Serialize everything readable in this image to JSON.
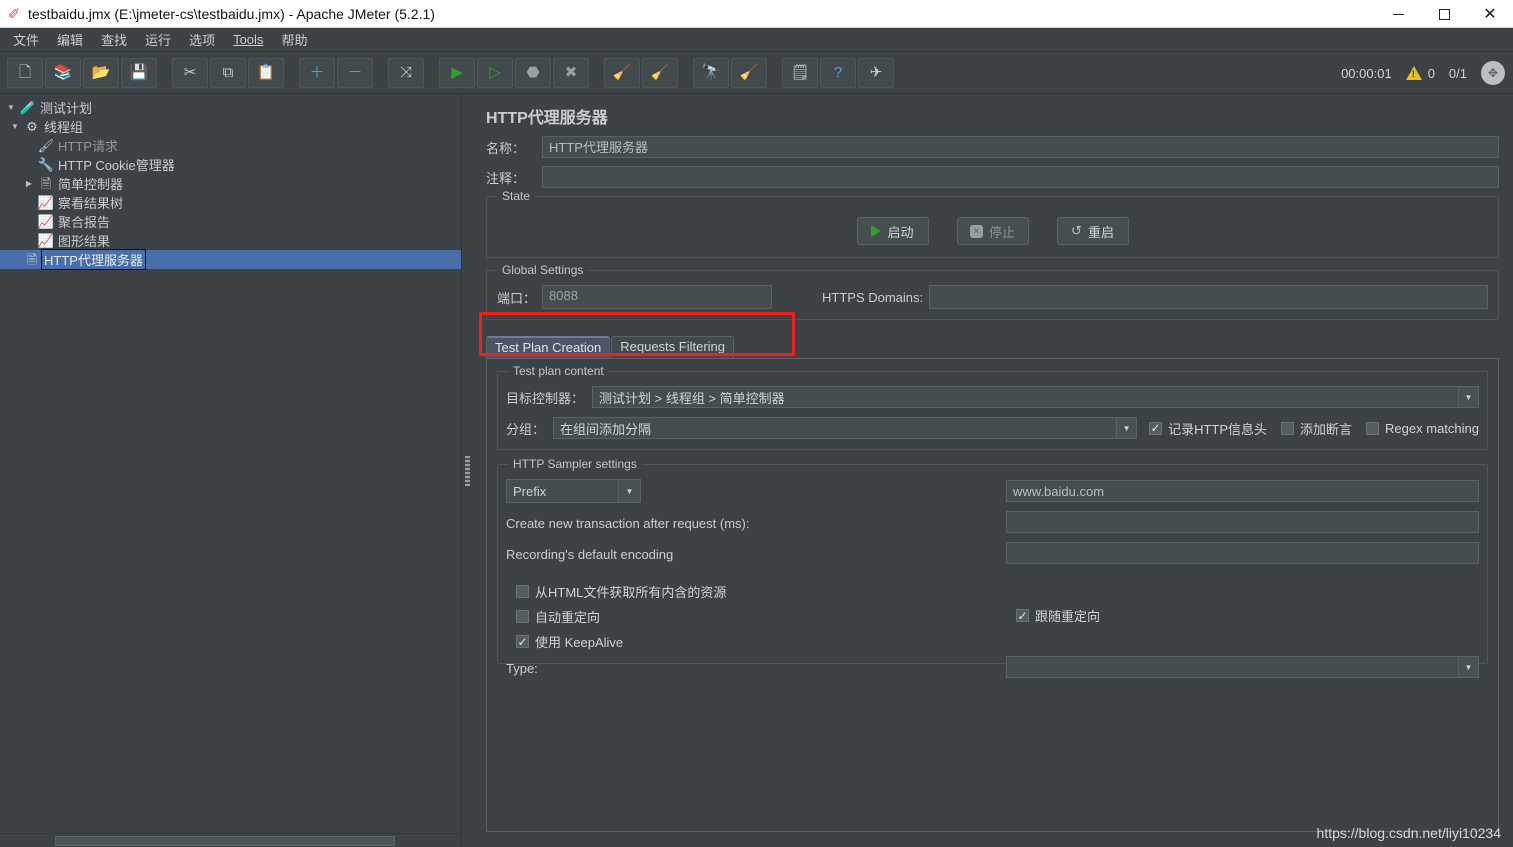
{
  "window": {
    "title": "testbaidu.jmx (E:\\jmeter-cs\\testbaidu.jmx) - Apache JMeter (5.2.1)",
    "app_icon": "jmeter-feather-icon",
    "minimize": "—",
    "maximize": "□",
    "close": "✕"
  },
  "menu": [
    {
      "label": "文件"
    },
    {
      "label": "编辑"
    },
    {
      "label": "查找"
    },
    {
      "label": "运行"
    },
    {
      "label": "选项"
    },
    {
      "label": "Tools"
    },
    {
      "label": "帮助"
    }
  ],
  "toolbar": {
    "buttons": [
      {
        "name": "new-button",
        "glyph": "🗋"
      },
      {
        "name": "templates-button",
        "glyph": "📚"
      },
      {
        "name": "open-button",
        "glyph": "📂"
      },
      {
        "name": "save-button",
        "glyph": "💾"
      },
      {
        "name": "cut-button",
        "glyph": "✂"
      },
      {
        "name": "copy-button",
        "glyph": "⧉"
      },
      {
        "name": "paste-button",
        "glyph": "📋"
      },
      {
        "name": "expand-button",
        "glyph": "＋"
      },
      {
        "name": "collapse-button",
        "glyph": "－"
      },
      {
        "name": "toggle-button",
        "glyph": "⤨"
      },
      {
        "name": "start-button",
        "glyph": "▶"
      },
      {
        "name": "start-no-pauses-button",
        "glyph": "▷"
      },
      {
        "name": "stop-button",
        "glyph": "⬣"
      },
      {
        "name": "shutdown-button",
        "glyph": "✖"
      },
      {
        "name": "clear-button",
        "glyph": "🧹"
      },
      {
        "name": "clear-all-button",
        "glyph": "🧹"
      },
      {
        "name": "search-button",
        "glyph": "🔭"
      },
      {
        "name": "reset-search-button",
        "glyph": "🧹"
      },
      {
        "name": "function-helper-button",
        "glyph": "🗒"
      },
      {
        "name": "help-button",
        "glyph": "?"
      },
      {
        "name": "undo-redo-button",
        "glyph": "✈"
      }
    ],
    "elapsed_time": "00:00:01",
    "warning_count": "0",
    "thread_count": "0/1",
    "status_icon": "target-icon"
  },
  "tree": {
    "nodes": [
      {
        "label": "测试计划",
        "icon": "test-plan-icon",
        "toggle": "▼",
        "indent": 0,
        "selected": false,
        "disabled": false
      },
      {
        "label": "线程组",
        "icon": "thread-group-icon",
        "toggle": "▼",
        "indent": 1,
        "selected": false,
        "disabled": false
      },
      {
        "label": "HTTP请求",
        "icon": "http-request-icon",
        "toggle": "",
        "indent": 2,
        "selected": false,
        "disabled": true
      },
      {
        "label": "HTTP Cookie管理器",
        "icon": "cookie-manager-icon",
        "toggle": "",
        "indent": 2,
        "selected": false,
        "disabled": false
      },
      {
        "label": "简单控制器",
        "icon": "controller-icon",
        "toggle": "▶",
        "indent": 2,
        "selected": false,
        "disabled": false
      },
      {
        "label": "察看结果树",
        "icon": "view-results-tree-icon",
        "toggle": "",
        "indent": 2,
        "selected": false,
        "disabled": false
      },
      {
        "label": "聚合报告",
        "icon": "aggregate-report-icon",
        "toggle": "",
        "indent": 2,
        "selected": false,
        "disabled": false
      },
      {
        "label": "图形结果",
        "icon": "graph-results-icon",
        "toggle": "",
        "indent": 2,
        "selected": false,
        "disabled": false
      },
      {
        "label": "HTTP代理服务器",
        "icon": "http-proxy-server-icon",
        "toggle": "",
        "indent": 1,
        "selected": true,
        "disabled": false
      }
    ]
  },
  "panel": {
    "title": "HTTP代理服务器",
    "name_label": "名称：",
    "name_value": "HTTP代理服务器",
    "comment_label": "注释：",
    "comment_value": "",
    "state": {
      "legend": "State",
      "start_label": "启动",
      "stop_label": "停止",
      "restart_label": "重启"
    },
    "global_settings": {
      "legend": "Global Settings",
      "port_label": "端口：",
      "port_value": "8088",
      "https_domains_label": "HTTPS Domains:",
      "https_domains_value": ""
    },
    "tabs": [
      {
        "label": "Test Plan Creation",
        "active": true
      },
      {
        "label": "Requests Filtering",
        "active": false
      }
    ],
    "test_plan_content": {
      "legend": "Test plan content",
      "target_controller_label": "目标控制器：",
      "target_controller_value": "测试计划 > 线程组 > 简单控制器",
      "grouping_label": "分组：",
      "grouping_value": "在组间添加分隔",
      "checkboxes": [
        {
          "label": "记录HTTP信息头",
          "checked": true
        },
        {
          "label": "添加断言",
          "checked": false
        },
        {
          "label": "Regex matching",
          "checked": false
        }
      ]
    },
    "sampler_settings": {
      "legend": "HTTP Sampler settings",
      "prefix_label": "Prefix",
      "prefix_value": "www.baidu.com",
      "transaction_label": "Create new transaction after request (ms):",
      "transaction_value": "",
      "encoding_label": "Recording's default encoding",
      "encoding_value": "",
      "checkboxes_left": [
        {
          "label": "从HTML文件获取所有内含的资源",
          "checked": false
        },
        {
          "label": "自动重定向",
          "checked": false
        },
        {
          "label": "使用 KeepAlive",
          "checked": true
        }
      ],
      "checkboxes_right": [
        {
          "label": "跟随重定向",
          "checked": true
        }
      ],
      "type_label": "Type:",
      "type_value": ""
    },
    "watermark": "https://blog.csdn.net/liyi10234"
  },
  "annotation": {
    "highlight_color": "#ee2020",
    "target": "port-field-highlight"
  }
}
